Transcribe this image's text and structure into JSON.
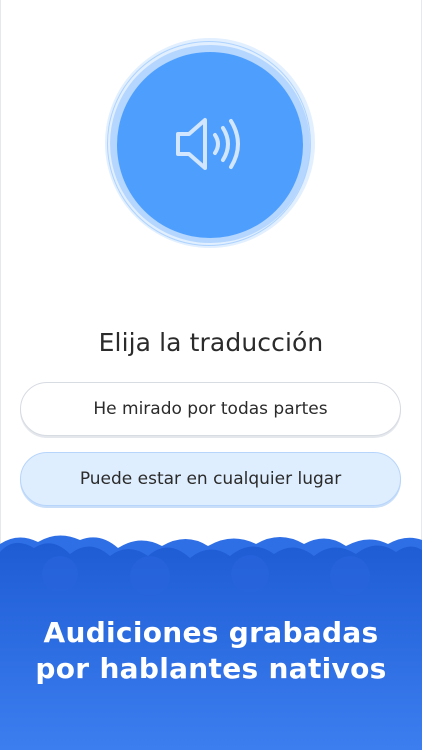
{
  "speaker": {
    "icon": "speaker-volume-icon",
    "accent": "#4e9ffd"
  },
  "prompt": {
    "title": "Elija la traducción"
  },
  "options": [
    {
      "label": "He mirado por todas partes",
      "selected": false
    },
    {
      "label": "Puede estar en cualquier lugar",
      "selected": true
    }
  ],
  "banner": {
    "line1": "Audiciones grabadas",
    "line2": "por hablantes nativos",
    "color": "#1f5fd6"
  }
}
